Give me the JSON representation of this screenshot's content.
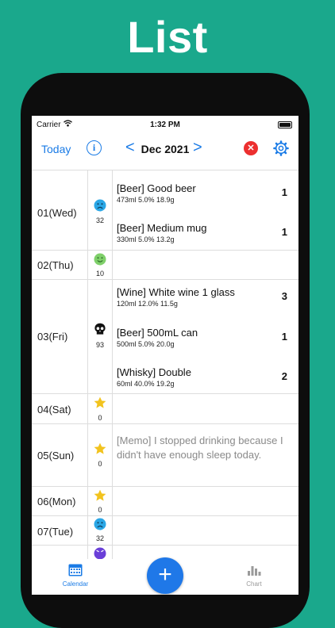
{
  "banner": {
    "title": "List"
  },
  "status_bar": {
    "carrier": "Carrier",
    "time": "1:32 PM"
  },
  "nav": {
    "today_label": "Today",
    "info_icon": "i",
    "prev": "<",
    "month": "Dec 2021",
    "next": ">",
    "clear_icon": "✕"
  },
  "days": [
    {
      "label": "01(Wed)",
      "mood_icon": "sad-face-icon",
      "mood_value": "32",
      "entries": [
        {
          "title": "[Beer] Good beer",
          "detail": "473ml  5.0%  18.9g",
          "count": "1"
        },
        {
          "title": "[Beer] Medium mug",
          "detail": "330ml  5.0%  13.2g",
          "count": "1"
        }
      ]
    },
    {
      "label": "02(Thu)",
      "mood_icon": "happy-face-icon",
      "mood_value": "10",
      "entries": []
    },
    {
      "label": "03(Fri)",
      "mood_icon": "skull-icon",
      "mood_value": "93",
      "entries": [
        {
          "title": "[Wine] White wine 1 glass",
          "detail": "120ml  12.0%  11.5g",
          "count": "3"
        },
        {
          "title": "[Beer] 500mL can",
          "detail": "500ml  5.0%  20.0g",
          "count": "1"
        },
        {
          "title": "[Whisky] Double",
          "detail": "60ml  40.0%  19.2g",
          "count": "2"
        }
      ]
    },
    {
      "label": "04(Sat)",
      "mood_icon": "star-icon",
      "mood_value": "0",
      "entries": []
    },
    {
      "label": "05(Sun)",
      "mood_icon": "star-icon",
      "mood_value": "0",
      "entries": [],
      "memo": "[Memo] I stopped drinking because I didn't have enough sleep today."
    },
    {
      "label": "06(Mon)",
      "mood_icon": "star-icon",
      "mood_value": "0",
      "entries": []
    },
    {
      "label": "07(Tue)",
      "mood_icon": "sad-face-icon",
      "mood_value": "32",
      "entries": []
    }
  ],
  "tabbar": {
    "calendar_label": "Calendar",
    "add_icon": "+",
    "chart_label": "Chart"
  },
  "colors": {
    "background": "#1aa88c",
    "accent": "#1a7be6",
    "danger": "#ec2f2f"
  }
}
